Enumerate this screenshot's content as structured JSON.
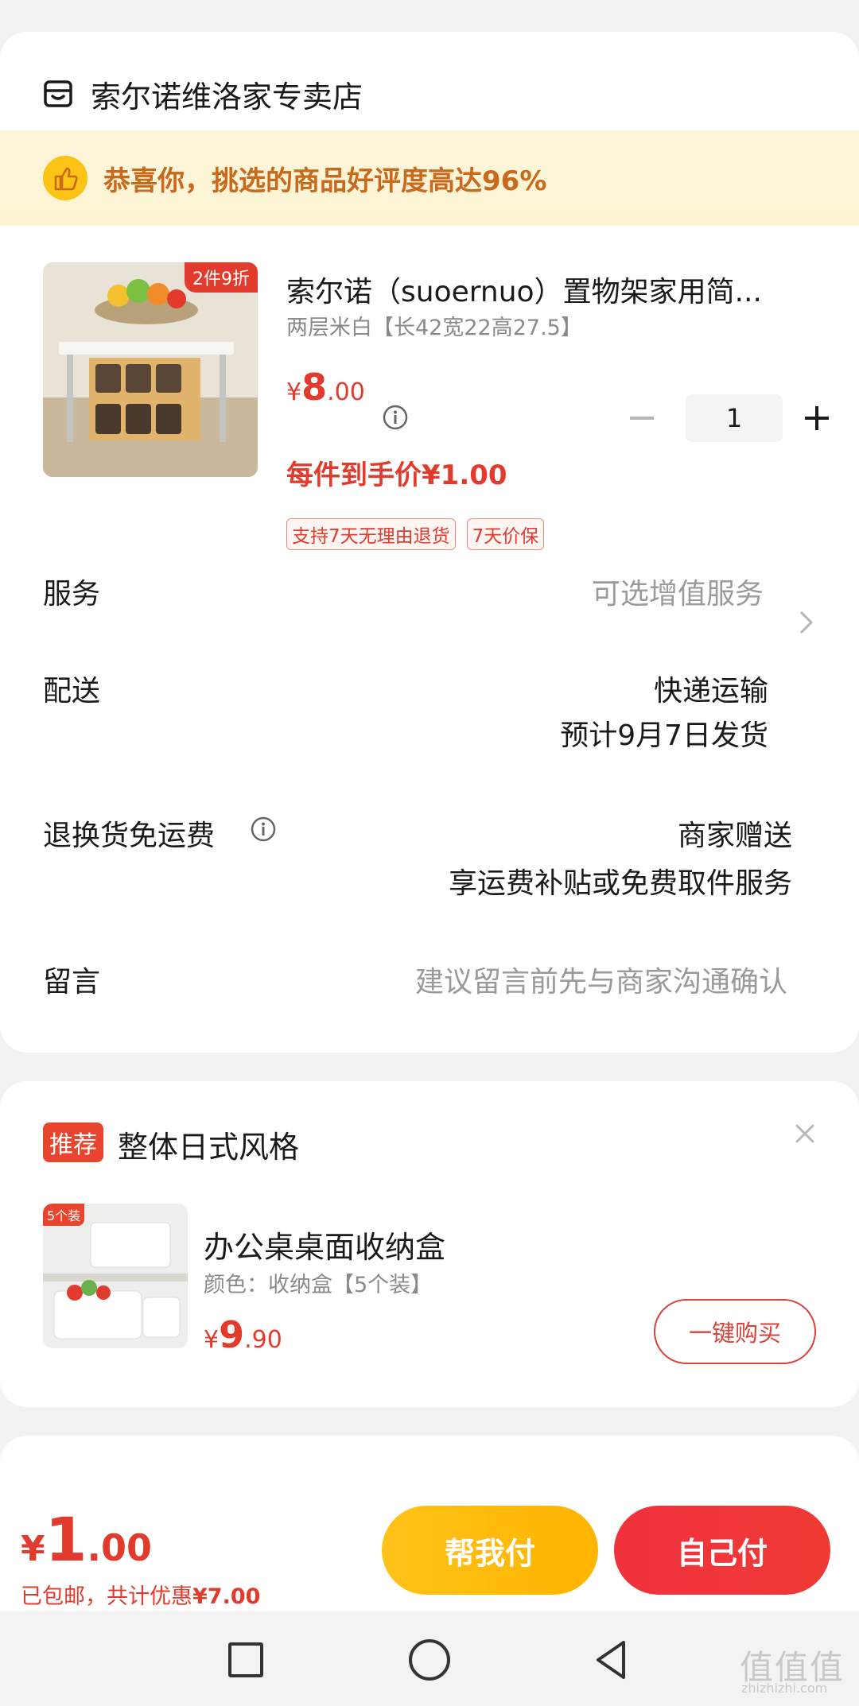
{
  "store": {
    "name": "索尔诺维洛家专卖店",
    "praise": "恭喜你，挑选的商品好评度高达96%"
  },
  "product": {
    "badge": "2件9折",
    "title": "索尔诺（suoernuo）置物架家用简...",
    "spec": "两层米白【长42宽22高27.5】",
    "price_yen": "¥",
    "price_int": "8",
    "price_dec": ".00",
    "final_price": "每件到手价¥1.00",
    "quantity": "1",
    "tags": [
      "支持7天无理由退货",
      "7天价保"
    ]
  },
  "rows": {
    "service_label": "服务",
    "service_value": "可选增值服务",
    "delivery_label": "配送",
    "delivery_value_1": "快递运输",
    "delivery_value_2": "预计9月7日发货",
    "return_label": "退换货免运费",
    "return_value_1": "商家赠送",
    "return_value_2": "享运费补贴或免费取件服务",
    "message_label": "留言",
    "message_placeholder": "建议留言前先与商家沟通确认"
  },
  "recommend": {
    "tag": "推荐",
    "title": "整体日式风格",
    "img_badge": "5个装",
    "name": "办公桌桌面收纳盒",
    "spec": "颜色：收纳盒【5个装】",
    "price_yen": "¥",
    "price_int": "9",
    "price_dec": ".90",
    "buy_label": "一键购买"
  },
  "bottom": {
    "total_yen": "¥",
    "total_int": "1",
    "total_dec": ".00",
    "note_prefix": "已包邮，共计优惠",
    "note_amount": "¥7.00",
    "help_pay": "帮我付",
    "self_pay": "自己付"
  },
  "watermark": {
    "main": "值值值",
    "sub": "zhizhizhi.com"
  },
  "colors": {
    "accent_red": "#e23b2e",
    "accent_yellow": "#ffb400",
    "praise_orange": "#c8691c"
  }
}
